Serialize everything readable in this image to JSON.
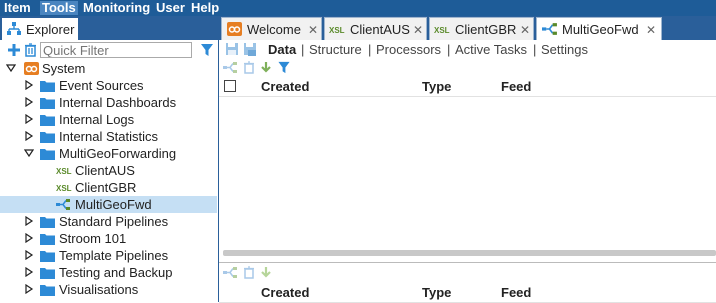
{
  "menu": [
    "Item",
    "Tools",
    "Monitoring",
    "User",
    "Help"
  ],
  "explorer": {
    "tab_label": "Explorer",
    "quick_filter_placeholder": "Quick Filter",
    "tree": [
      {
        "label": "System",
        "icon": "system-icon"
      },
      {
        "label": "Event Sources",
        "icon": "folder-icon"
      },
      {
        "label": "Internal Dashboards",
        "icon": "folder-icon"
      },
      {
        "label": "Internal Logs",
        "icon": "folder-icon"
      },
      {
        "label": "Internal Statistics",
        "icon": "folder-icon"
      },
      {
        "label": "MultiGeoForwarding",
        "icon": "folder-icon"
      },
      {
        "label": "ClientAUS",
        "icon": "xslt-icon"
      },
      {
        "label": "ClientGBR",
        "icon": "xslt-icon"
      },
      {
        "label": "MultiGeoFwd",
        "icon": "pipeline-icon"
      },
      {
        "label": "Standard Pipelines",
        "icon": "folder-icon"
      },
      {
        "label": "Stroom 101",
        "icon": "folder-icon"
      },
      {
        "label": "Template Pipelines",
        "icon": "folder-icon"
      },
      {
        "label": "Testing and Backup",
        "icon": "folder-icon"
      },
      {
        "label": "Visualisations",
        "icon": "folder-icon"
      }
    ]
  },
  "tabs": [
    {
      "label": "Welcome",
      "icon": "welcome-icon"
    },
    {
      "label": "ClientAUS",
      "icon": "xslt-icon"
    },
    {
      "label": "ClientGBR",
      "icon": "xslt-icon"
    },
    {
      "label": "MultiGeoFwd",
      "icon": "pipeline-icon",
      "active": true
    }
  ],
  "subnav": [
    "Data",
    "Structure",
    "Processors",
    "Active Tasks",
    "Settings"
  ],
  "subnav_separator": "|",
  "table": {
    "columns": [
      "Created",
      "Type",
      "Feed"
    ]
  },
  "colors": {
    "header_blue": "#1e5c98",
    "folder_blue": "#2d8ad6",
    "welcome_orange": "#e67e22",
    "xslt_green": "#5a8a2a",
    "selected_row": "#c5dff4"
  }
}
